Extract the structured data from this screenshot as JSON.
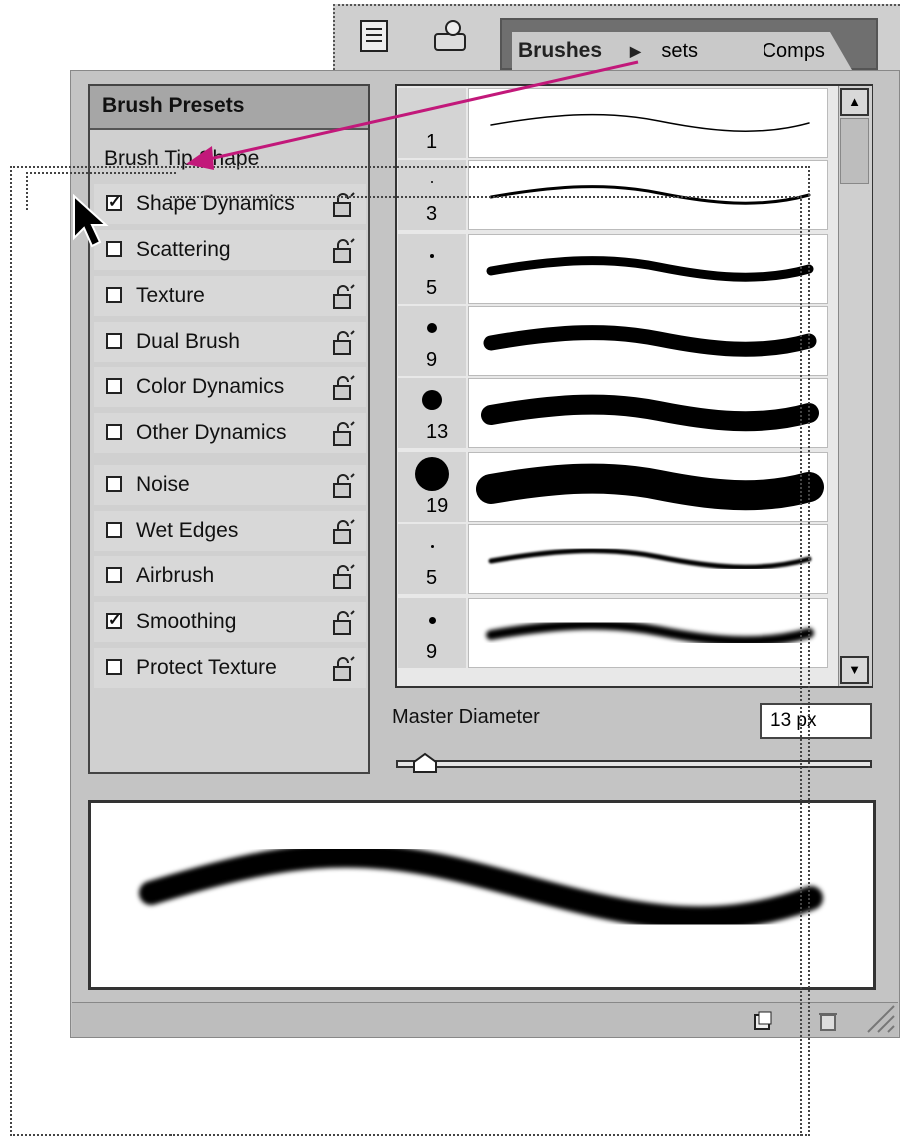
{
  "tabs": {
    "brushes": "Brushes",
    "tool_presets": "Tool Presets",
    "layer_comps": "Layer Comps"
  },
  "panel": {
    "header": "Brush Presets",
    "tip_shape": "Brush Tip Shape",
    "items": [
      {
        "label": "Shape Dynamics",
        "checked": true
      },
      {
        "label": "Scattering",
        "checked": false
      },
      {
        "label": "Texture",
        "checked": false
      },
      {
        "label": "Dual Brush",
        "checked": false
      },
      {
        "label": "Color Dynamics",
        "checked": false
      },
      {
        "label": "Other Dynamics",
        "checked": false
      },
      {
        "label": "Noise",
        "checked": false
      },
      {
        "label": "Wet Edges",
        "checked": false
      },
      {
        "label": "Airbrush",
        "checked": false
      },
      {
        "label": "Smoothing",
        "checked": true
      },
      {
        "label": "Protect Texture",
        "checked": false
      }
    ]
  },
  "brushes": [
    {
      "size": "1"
    },
    {
      "size": "3"
    },
    {
      "size": "5"
    },
    {
      "size": "9"
    },
    {
      "size": "13"
    },
    {
      "size": "19"
    },
    {
      "size": "5"
    },
    {
      "size": "9"
    }
  ],
  "master_diameter": {
    "label": "Master Diameter",
    "value": "13 px",
    "slider_fraction": 0.06
  },
  "icons": [
    "document-icon",
    "hand-icon",
    "flyout-arrow-icon",
    "lock-icon",
    "scroll-up-icon",
    "scroll-down-icon",
    "new-brush-icon",
    "trash-icon",
    "resize-grip-icon",
    "cursor-arrow-icon"
  ],
  "colors": {
    "arrow": "#c2187a"
  }
}
